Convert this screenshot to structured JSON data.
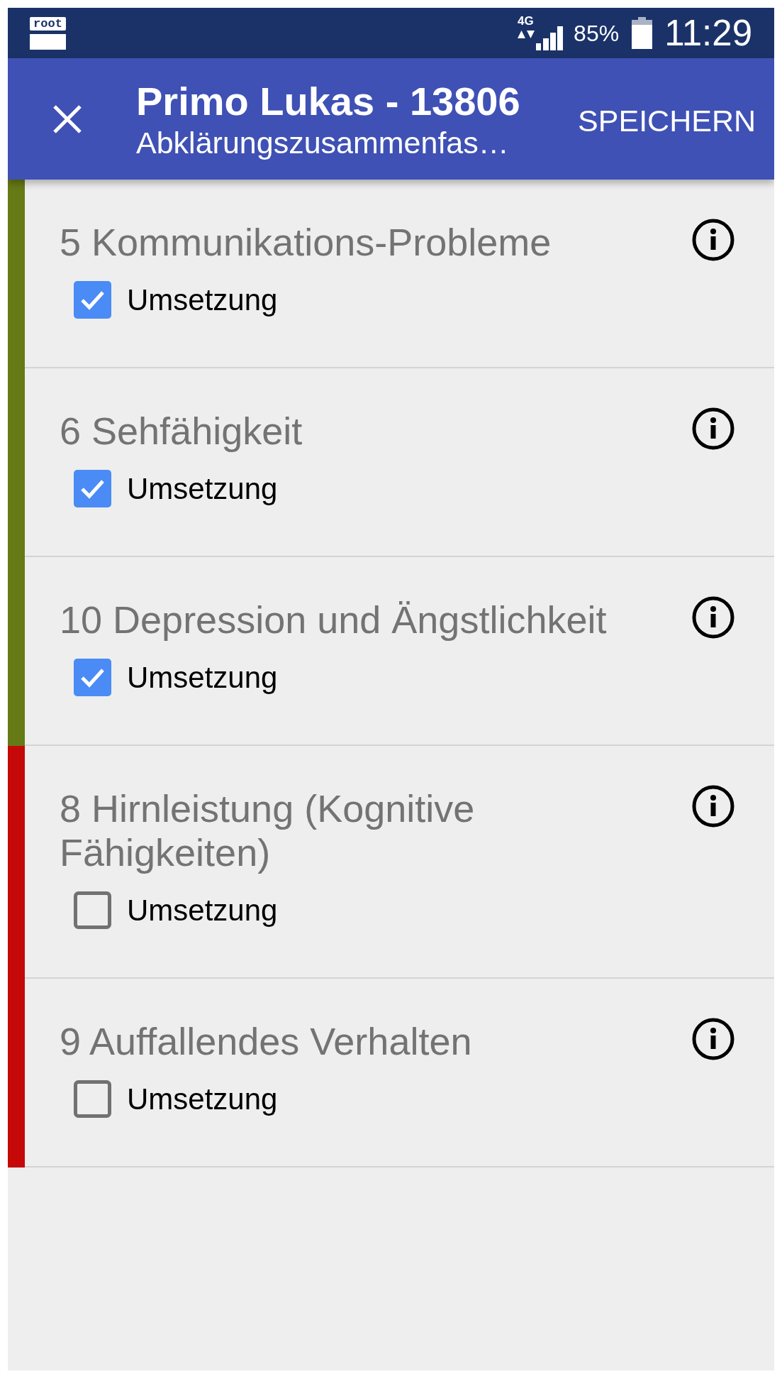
{
  "status_bar": {
    "app_icon_text": "root",
    "network_type": "4G",
    "battery": "85%",
    "time": "11:29"
  },
  "app_bar": {
    "title": "Primo Lukas - 13806",
    "subtitle": "Abklärungszusammenfas…",
    "action": "SPEICHERN"
  },
  "items": [
    {
      "title": "5 Kommunikations-Probleme",
      "color": "#667a16",
      "checkbox": {
        "label": "Umsetzung",
        "checked": true
      }
    },
    {
      "title": "6 Sehfähigkeit",
      "color": "#667a16",
      "checkbox": {
        "label": "Umsetzung",
        "checked": true
      }
    },
    {
      "title": "10 Depression und Ängstlichkeit",
      "color": "#667a16",
      "checkbox": {
        "label": "Umsetzung",
        "checked": true
      }
    },
    {
      "title": "8 Hirnleistung (Kognitive Fähigkeiten)",
      "color": "#c50808",
      "checkbox": {
        "label": "Umsetzung",
        "checked": false
      }
    },
    {
      "title": "9 Auffallendes Verhalten",
      "color": "#c50808",
      "checkbox": {
        "label": "Umsetzung",
        "checked": false
      }
    }
  ]
}
